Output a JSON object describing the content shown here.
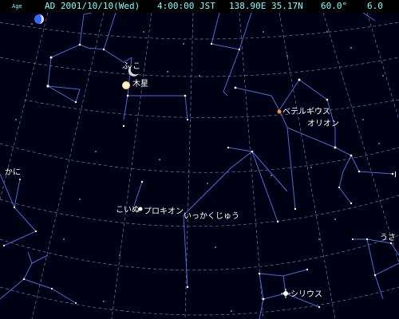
{
  "status": {
    "moon_icon": "moon-phase-icon",
    "moon_age": "Age",
    "date": "AD 2001/10/10(Wed)",
    "time": "4:00:00 JST",
    "location": "138.90E 35.17N",
    "fov": "60.0°",
    "magnitude_limit": "6.0"
  },
  "labels": {
    "fune": "ふ  こ",
    "jupiter": "木星",
    "betelgeuse": "ベテルギウス",
    "orion": "オリオン",
    "kani": "かに",
    "koinu_procyon": "こいぬ",
    "procyon": "プロキオン",
    "ikkakujuu": "いっかくじゅう",
    "usagi": "うさ",
    "sirius": "シリウス",
    "edge_right": "I"
  },
  "colors": {
    "background": "#000014",
    "constellation_line": "#4a6cd0",
    "grid": "#5f7fa8",
    "status_text": "#7CFFFF",
    "betelgeuse": "#ff9040",
    "jupiter": "#ffe8a0"
  }
}
